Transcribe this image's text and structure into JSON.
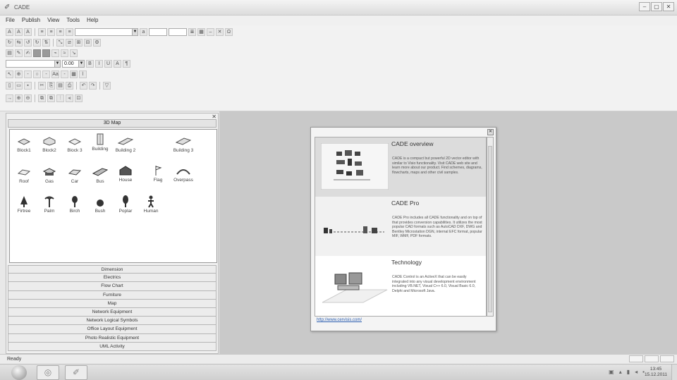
{
  "window": {
    "title": "CADE",
    "controls": [
      "–",
      "▢",
      "✕"
    ]
  },
  "menu": [
    "File",
    "Publish",
    "View",
    "Tools",
    "Help"
  ],
  "toolbar": {
    "font_size": "0.00"
  },
  "panel": {
    "header": "3D Map",
    "shapes": [
      {
        "label": "Block1",
        "icon": "block-icon"
      },
      {
        "label": "Block2",
        "icon": "block-icon"
      },
      {
        "label": "Block 3",
        "icon": "block-icon"
      },
      {
        "label": "Building",
        "icon": "building-icon"
      },
      {
        "label": "Building 2",
        "icon": "building-icon"
      },
      {
        "label": "Building 3",
        "icon": "building-icon"
      },
      {
        "label": "Roof",
        "icon": "roof-icon"
      },
      {
        "label": "Gas",
        "icon": "gas-icon"
      },
      {
        "label": "Car",
        "icon": "car-icon"
      },
      {
        "label": "Bus",
        "icon": "bus-icon"
      },
      {
        "label": "House",
        "icon": "house-icon"
      },
      {
        "label": "Flag",
        "icon": "flag-icon"
      },
      {
        "label": "Overpass",
        "icon": "overpass-icon"
      },
      {
        "label": "Firtree",
        "icon": "firtree-icon"
      },
      {
        "label": "Palm",
        "icon": "palm-icon"
      },
      {
        "label": "Birch",
        "icon": "birch-icon"
      },
      {
        "label": "Bush",
        "icon": "bush-icon"
      },
      {
        "label": "Poplar",
        "icon": "poplar-icon"
      },
      {
        "label": "Human",
        "icon": "human-icon"
      }
    ],
    "categories": [
      "Dimension",
      "Electrics",
      "Flow Chart",
      "Furniture",
      "Map",
      "Network Equipment",
      "Network Logical Symbols",
      "Office Layout Equipment",
      "Photo Realistic Equipment",
      "UML Activity"
    ]
  },
  "dialog": {
    "sections": [
      {
        "title": "CADE overview",
        "body": "CADE is a compact but powerful 2D vector editor with similar to Visio functionality. Visit CADE web site and learn more about our product. Find schemes, diagrams, flowcharts, maps and other civil samples."
      },
      {
        "title": "CADE Pro",
        "body": "CADE Pro includes all CADE functionality and on top of that provides conversion capabilities. It utilizes the most popular CAD formats such as AutoCAD DXF, DWG and Bentley Microstation DGN, internal EFC format, popular MIF, WMF, PDF formats."
      },
      {
        "title": "Technology",
        "body": "CADE Control is an ActiveX that can be easily integrated into any visual development environment including VB.NET, Visual C++ 6.0, Visual Basic 6.0, Delphi and Microsoft Java."
      }
    ],
    "link": "http://www.cervisis.com/"
  },
  "status": {
    "text": "Ready"
  },
  "taskbar": {
    "time": "13:45",
    "date": "15.12.2011"
  }
}
